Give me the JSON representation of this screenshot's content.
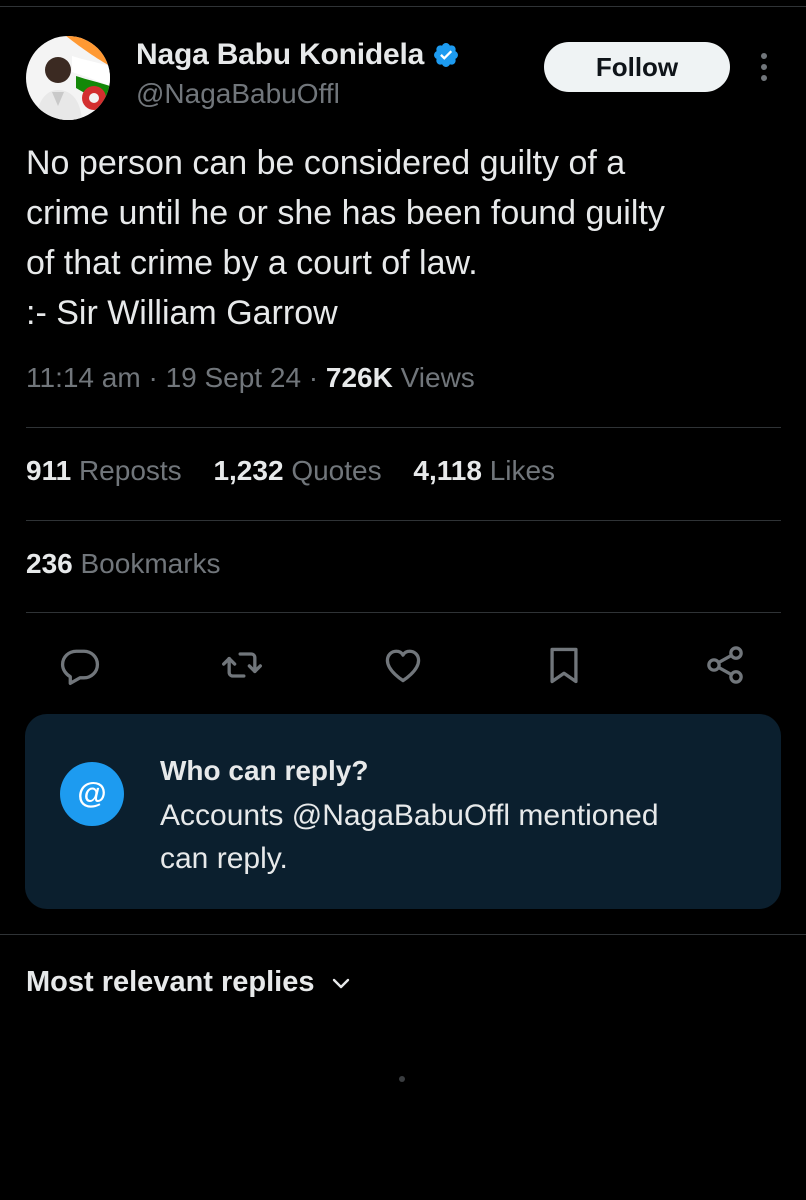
{
  "author": {
    "name": "Naga Babu Konidela",
    "handle": "@NagaBabuOffl",
    "verified": true
  },
  "follow_button_label": "Follow",
  "tweet": {
    "text_lines": [
      "No person can be considered guilty of a",
      "crime until he or she has been found guilty",
      "of that crime by a court of law.",
      ":- Sir William Garrow"
    ],
    "time": "11:14 am",
    "separator": "·",
    "date": "19 Sept 24",
    "views_count": "726K",
    "views_label": "Views"
  },
  "stats": {
    "reposts": {
      "count": "911",
      "label": "Reposts"
    },
    "quotes": {
      "count": "1,232",
      "label": "Quotes"
    },
    "likes": {
      "count": "4,118",
      "label": "Likes"
    },
    "bookmarks": {
      "count": "236",
      "label": "Bookmarks"
    }
  },
  "actions": [
    {
      "name": "reply-icon"
    },
    {
      "name": "repost-icon"
    },
    {
      "name": "like-icon"
    },
    {
      "name": "bookmark-icon"
    },
    {
      "name": "share-icon"
    }
  ],
  "reply_restriction": {
    "icon_symbol": "@",
    "title": "Who can reply?",
    "description_lines": [
      "Accounts @NagaBabuOffl mentioned",
      "can reply."
    ]
  },
  "replies_sort": {
    "label": "Most relevant replies"
  },
  "colors": {
    "background": "#000000",
    "text_primary": "#e7e9ea",
    "text_secondary": "#71767b",
    "accent": "#1d9bf0",
    "card_background": "#0b1f2e",
    "divider": "#2f3336"
  }
}
